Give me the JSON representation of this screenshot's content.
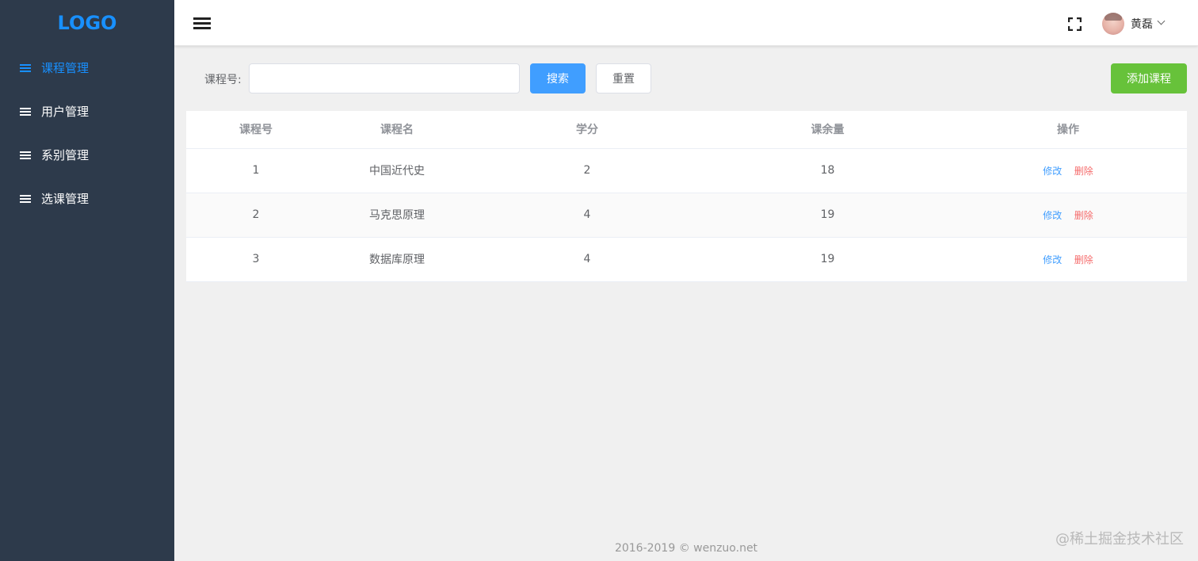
{
  "sidebar": {
    "logo": "LOGO",
    "items": [
      {
        "label": "课程管理",
        "active": true
      },
      {
        "label": "用户管理",
        "active": false
      },
      {
        "label": "系别管理",
        "active": false
      },
      {
        "label": "选课管理",
        "active": false
      }
    ]
  },
  "header": {
    "username": "黄磊"
  },
  "toolbar": {
    "search_label": "课程号:",
    "search_value": "",
    "search_button": "搜索",
    "reset_button": "重置",
    "add_button": "添加课程"
  },
  "table": {
    "columns": [
      "课程号",
      "课程名",
      "学分",
      "课余量",
      "操作"
    ],
    "rows": [
      {
        "id": "1",
        "name": "中国近代史",
        "credit": "2",
        "remaining": "18",
        "edit": "修改",
        "delete": "删除"
      },
      {
        "id": "2",
        "name": "马克思原理",
        "credit": "4",
        "remaining": "19",
        "edit": "修改",
        "delete": "删除"
      },
      {
        "id": "3",
        "name": "数据库原理",
        "credit": "4",
        "remaining": "19",
        "edit": "修改",
        "delete": "删除"
      }
    ]
  },
  "footer": {
    "copyright": "2016-2019 © wenzuo.net",
    "watermark": "@稀土掘金技术社区"
  },
  "colors": {
    "sidebar_bg": "#2d3a4b",
    "accent": "#409eff",
    "success": "#67c23a",
    "danger": "#f56c6c"
  }
}
